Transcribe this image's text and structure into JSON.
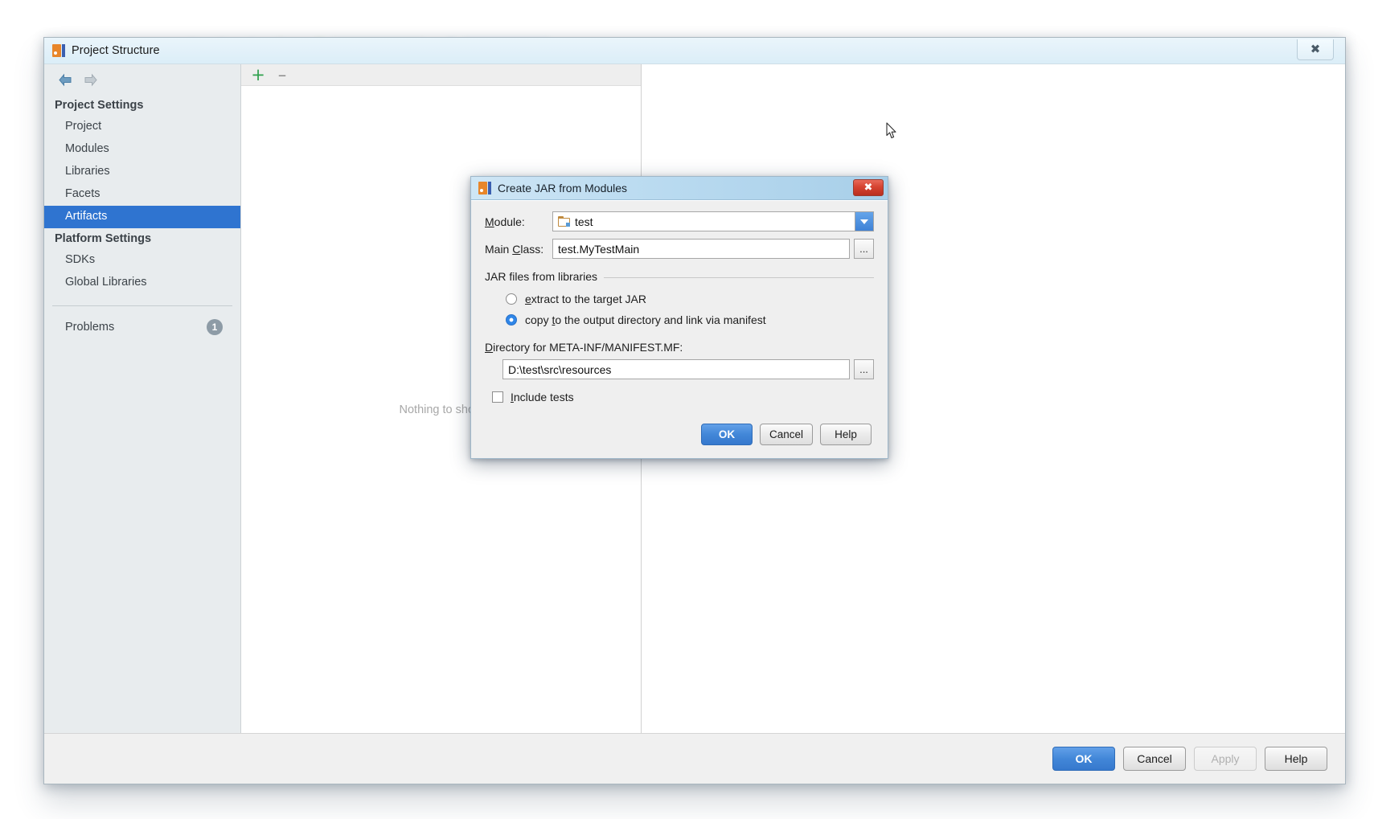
{
  "window": {
    "title": "Project Structure",
    "app_icon": "intellij-logo-icon",
    "close_label": "✕"
  },
  "sidebar": {
    "back_icon": "arrow-left-icon",
    "forward_icon": "arrow-right-icon",
    "groups": [
      {
        "title": "Project Settings",
        "items": [
          {
            "label": "Project",
            "selected": false
          },
          {
            "label": "Modules",
            "selected": false
          },
          {
            "label": "Libraries",
            "selected": false
          },
          {
            "label": "Facets",
            "selected": false
          },
          {
            "label": "Artifacts",
            "selected": true
          }
        ]
      },
      {
        "title": "Platform Settings",
        "items": [
          {
            "label": "SDKs",
            "selected": false
          },
          {
            "label": "Global Libraries",
            "selected": false
          }
        ]
      }
    ],
    "problems": {
      "label": "Problems",
      "count": "1"
    }
  },
  "list_panel": {
    "add_icon": "plus-icon",
    "add_glyph": "+",
    "remove_icon": "minus-icon",
    "remove_glyph": "–",
    "empty_text": "Nothing to show"
  },
  "footer": {
    "ok": "OK",
    "cancel": "Cancel",
    "apply": "Apply",
    "help": "Help"
  },
  "dialog": {
    "title": "Create JAR from Modules",
    "icon": "intellij-logo-icon",
    "close_glyph": "✕",
    "module": {
      "label_pre": "M",
      "label_post": "odule:",
      "value": "test",
      "icon": "module-folder-icon",
      "dropdown_icon": "chevron-down-icon"
    },
    "main_class": {
      "label_pre": "Main ",
      "label_mn": "C",
      "label_post": "lass:",
      "value": "test.MyTestMain",
      "browse_label": "...",
      "browse_icon": "browse-ellipsis-icon"
    },
    "jar_files_group": {
      "legend": "JAR files from libraries",
      "options": [
        {
          "pre": "",
          "mn": "e",
          "post": "xtract to the target JAR",
          "selected": false
        },
        {
          "pre": "copy ",
          "mn": "t",
          "post": "o the output directory and link via manifest",
          "selected": true
        }
      ]
    },
    "manifest_dir": {
      "label_mn": "D",
      "label_post": "irectory for META-INF/MANIFEST.MF:",
      "value": "D:\\test\\src\\resources",
      "browse_label": "...",
      "browse_icon": "browse-ellipsis-icon"
    },
    "include_tests": {
      "label_mn": "I",
      "label_post": "nclude tests",
      "checked": false
    },
    "buttons": {
      "ok": "OK",
      "cancel": "Cancel",
      "help": "Help"
    }
  },
  "colors": {
    "accent_blue": "#2f74d0",
    "selection_blue": "#3678cd",
    "close_red": "#d64331",
    "plus_green": "#30a14e",
    "badge_gray": "#8d9ba6"
  }
}
